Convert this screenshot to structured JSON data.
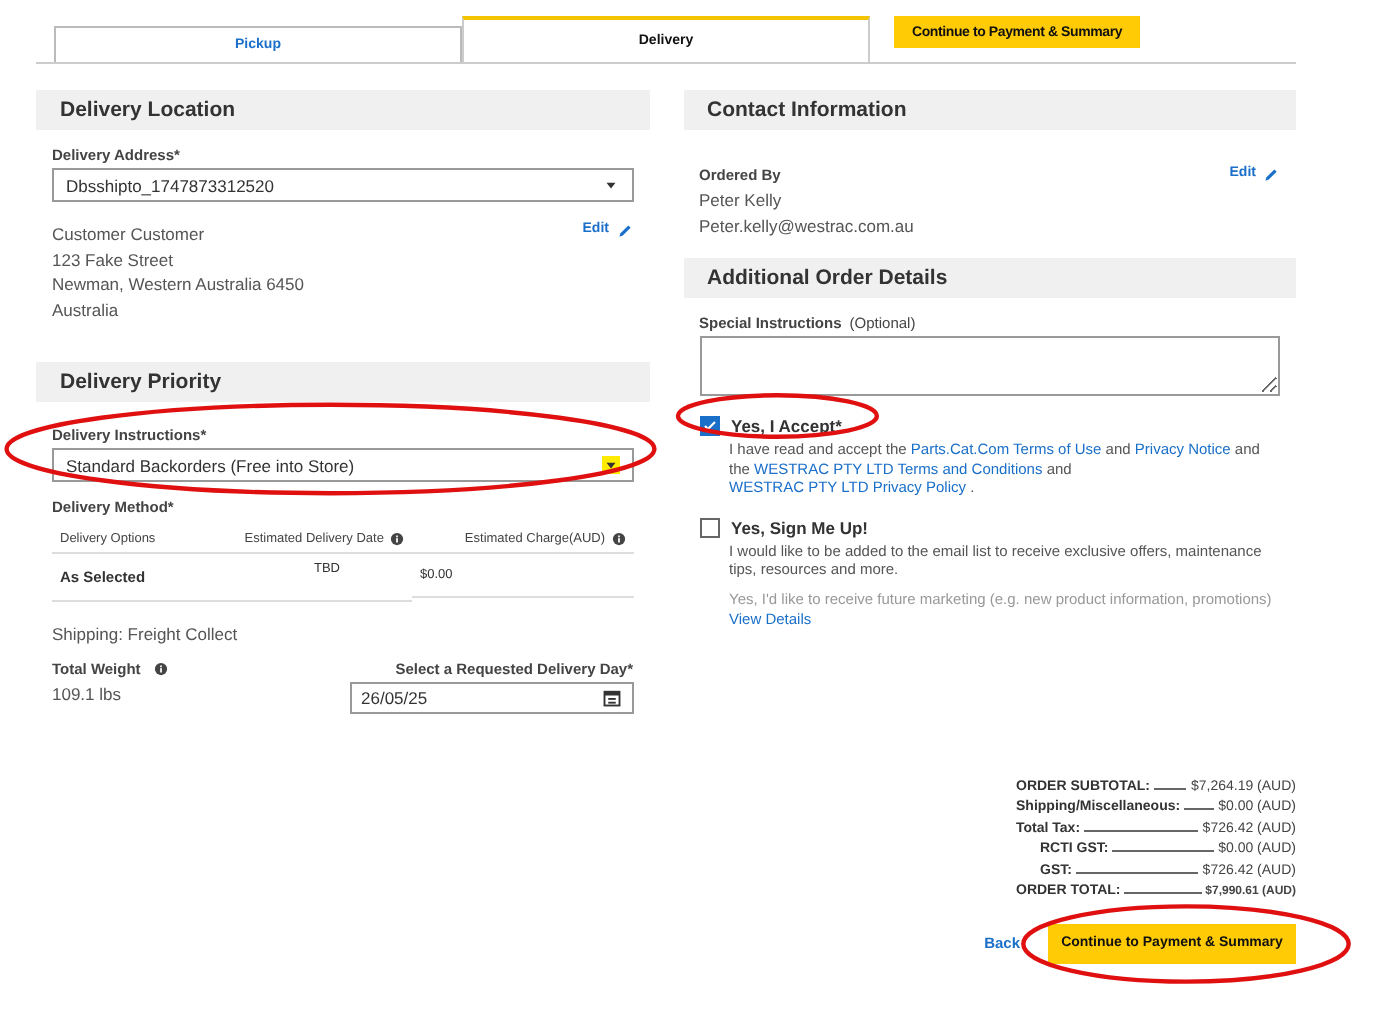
{
  "tabs": [
    {
      "label": "Pickup",
      "selected": false
    },
    {
      "label": "Delivery",
      "selected": true
    }
  ],
  "top_button": "Continue to Payment & Summary",
  "delivery_location": {
    "title": "Delivery Location",
    "address_label": "Delivery Address*",
    "address_value": "Dbsshipto_1747873312520",
    "edit": "Edit",
    "address_lines": [
      "Customer Customer",
      "123 Fake Street",
      "Newman, Western Australia 6450",
      "Australia"
    ]
  },
  "delivery_priority": {
    "title": "Delivery Priority",
    "instructions_label": "Delivery Instructions*",
    "instructions_value": "Standard Backorders (Free into Store)",
    "circled": true,
    "method_label": "Delivery Method*",
    "columns": [
      {
        "label": "Delivery Options",
        "info": false
      },
      {
        "label": "Estimated Delivery Date",
        "info": true
      },
      {
        "label": "Estimated Charge(AUD)",
        "info": true
      }
    ],
    "rows": [
      [
        "As Selected",
        "TBD",
        "$0.00"
      ]
    ],
    "shipping": "Shipping: Freight Collect",
    "weight_label": "Total Weight",
    "weight_value": "109.1 lbs",
    "day_label": "Select a Requested Delivery Day*",
    "day_value": "26/05/25"
  },
  "contact": {
    "title": "Contact Information",
    "ordered_by_label": "Ordered By",
    "lines": [
      "Peter Kelly",
      "Peter.kelly@westrac.com.au"
    ],
    "edit": "Edit"
  },
  "additional": {
    "title": "Additional Order Details",
    "special_label": "Special Instructions",
    "special_hint": "(Optional)",
    "checkboxes": [
      {
        "title": "Yes, I Accept*",
        "checked": true,
        "circled": true,
        "parts": [
          {
            "text": "I have read and accept the ",
            "link": false
          },
          {
            "text": "Parts.Cat.Com Terms of Use",
            "link": true
          },
          {
            "text": " and ",
            "link": false
          },
          {
            "text": "Privacy Notice",
            "link": true
          },
          {
            "text": " and the ",
            "link": false
          },
          {
            "text": "WESTRAC PTY LTD Terms and Conditions",
            "link": true
          },
          {
            "text": " and ",
            "link": false
          },
          {
            "text": "WESTRAC PTY LTD Privacy Policy",
            "link": true
          },
          {
            "text": " .",
            "link": false
          }
        ]
      },
      {
        "title": "Yes, Sign Me Up!",
        "checked": false,
        "circled": false,
        "parts": [
          {
            "text": "I would like to be added to the email list to receive exclusive offers, maintenance tips, resources and more.",
            "link": false
          }
        ],
        "faded": "Yes, I'd like to receive future marketing (e.g. new product information, promotions)",
        "details": "View Details"
      }
    ]
  },
  "summary": [
    {
      "label": "ORDER SUBTOTAL:",
      "value": "$7,264.19 (AUD)",
      "indent": false,
      "total": false
    },
    {
      "label": "Shipping/Miscellaneous:",
      "value": "$0.00 (AUD)",
      "indent": false,
      "total": false
    },
    {
      "label": "Total Tax:",
      "value": "$726.42 (AUD)",
      "indent": false,
      "total": false
    },
    {
      "label": "RCTI GST:",
      "value": "$0.00 (AUD)",
      "indent": true,
      "total": false
    },
    {
      "label": "GST:",
      "value": "$726.42 (AUD)",
      "indent": true,
      "total": false
    },
    {
      "label": "ORDER TOTAL:",
      "value": "$7,990.61 (AUD)",
      "indent": false,
      "total": true
    }
  ],
  "back": "Back",
  "bottom_button": {
    "label": "Continue to Payment & Summary",
    "circled": true
  }
}
